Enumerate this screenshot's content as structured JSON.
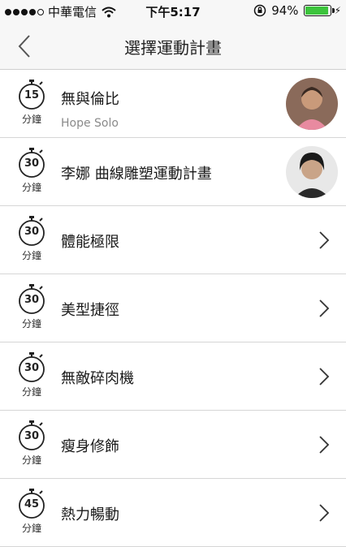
{
  "status_bar": {
    "carrier": "中華電信",
    "time": "下午5:17",
    "battery": "94%",
    "battery_level": 0.94,
    "battery_color": "#3cc43c"
  },
  "nav": {
    "title": "選擇運動計畫",
    "back_icon": "chevron-left-icon"
  },
  "timer_unit": "分鐘",
  "plans": [
    {
      "minutes": "15",
      "title": "無與倫比",
      "subtitle": "Hope Solo",
      "trailing": "avatar"
    },
    {
      "minutes": "30",
      "title": "李娜 曲線雕塑運動計畫",
      "subtitle": "",
      "trailing": "avatar"
    },
    {
      "minutes": "30",
      "title": "體能極限",
      "subtitle": "",
      "trailing": "chevron"
    },
    {
      "minutes": "30",
      "title": "美型捷徑",
      "subtitle": "",
      "trailing": "chevron"
    },
    {
      "minutes": "30",
      "title": "無敵碎肉機",
      "subtitle": "",
      "trailing": "chevron"
    },
    {
      "minutes": "30",
      "title": "瘦身修飾",
      "subtitle": "",
      "trailing": "chevron"
    },
    {
      "minutes": "45",
      "title": "熱力暢動",
      "subtitle": "",
      "trailing": "chevron"
    }
  ]
}
